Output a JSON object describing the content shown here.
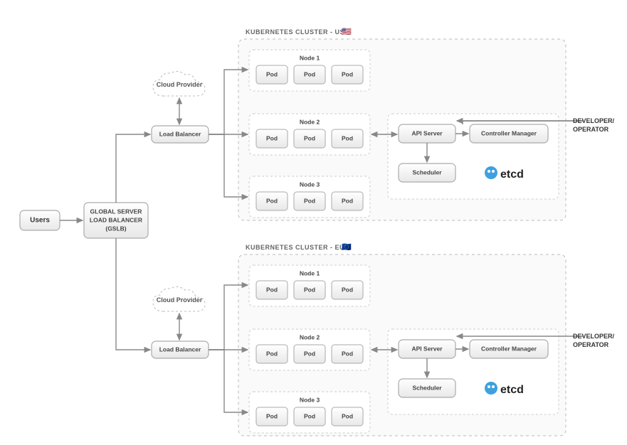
{
  "users": "Users",
  "gslb": {
    "line1": "GLOBAL SERVER",
    "line2": "LOAD BALANCER",
    "line3": "(GSLB)"
  },
  "cloud_provider": "Cloud Provider",
  "load_balancer": "Load Balancer",
  "cluster_us": {
    "title": "KUBERNETES CLUSTER - US",
    "flag": "🇺🇸"
  },
  "cluster_eu": {
    "title": "KUBERNETES CLUSTER - EU",
    "flag": "🇪🇺"
  },
  "nodes": [
    "Node 1",
    "Node 2",
    "Node 3"
  ],
  "pod": "Pod",
  "api_server": "API Server",
  "controller_manager": "Controller Manager",
  "scheduler": "Scheduler",
  "etcd": "etcd",
  "developer_operator": {
    "line1": "DEVELOPER/",
    "line2": "OPERATOR"
  }
}
